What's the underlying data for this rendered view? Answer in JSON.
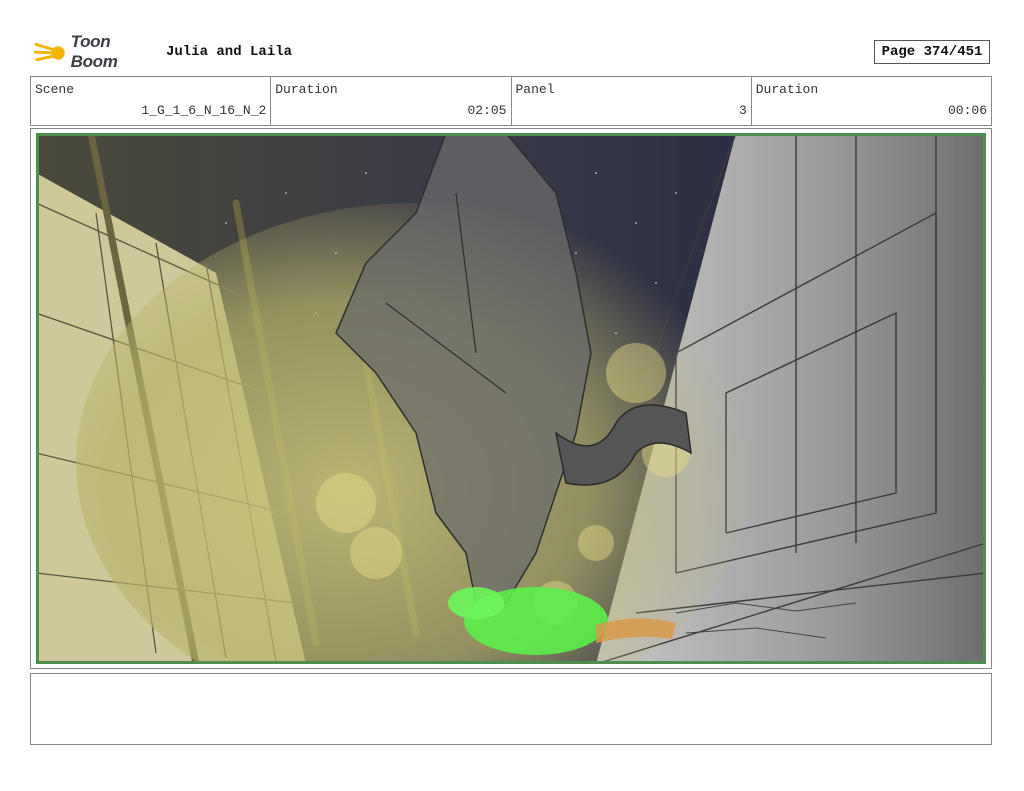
{
  "header": {
    "logo_text": "Toon Boom",
    "project_title": "Julia and Laila",
    "page_label": "Page 374/451"
  },
  "info": {
    "scene_label": "Scene",
    "scene_value": "1_G_1_6_N_16_N_2",
    "duration_label": "Duration",
    "duration_value": "02:05",
    "panel_label": "Panel",
    "panel_value": "3",
    "panel_duration_label": "Duration",
    "panel_duration_value": "00:06"
  },
  "colors": {
    "sky": "#1f2340",
    "glow": "#b8b46c",
    "creature": "#6b6b6b",
    "green_figure": "#5cf04a",
    "panel_border": "#4d8f4d"
  },
  "notes": {
    "text": ""
  }
}
